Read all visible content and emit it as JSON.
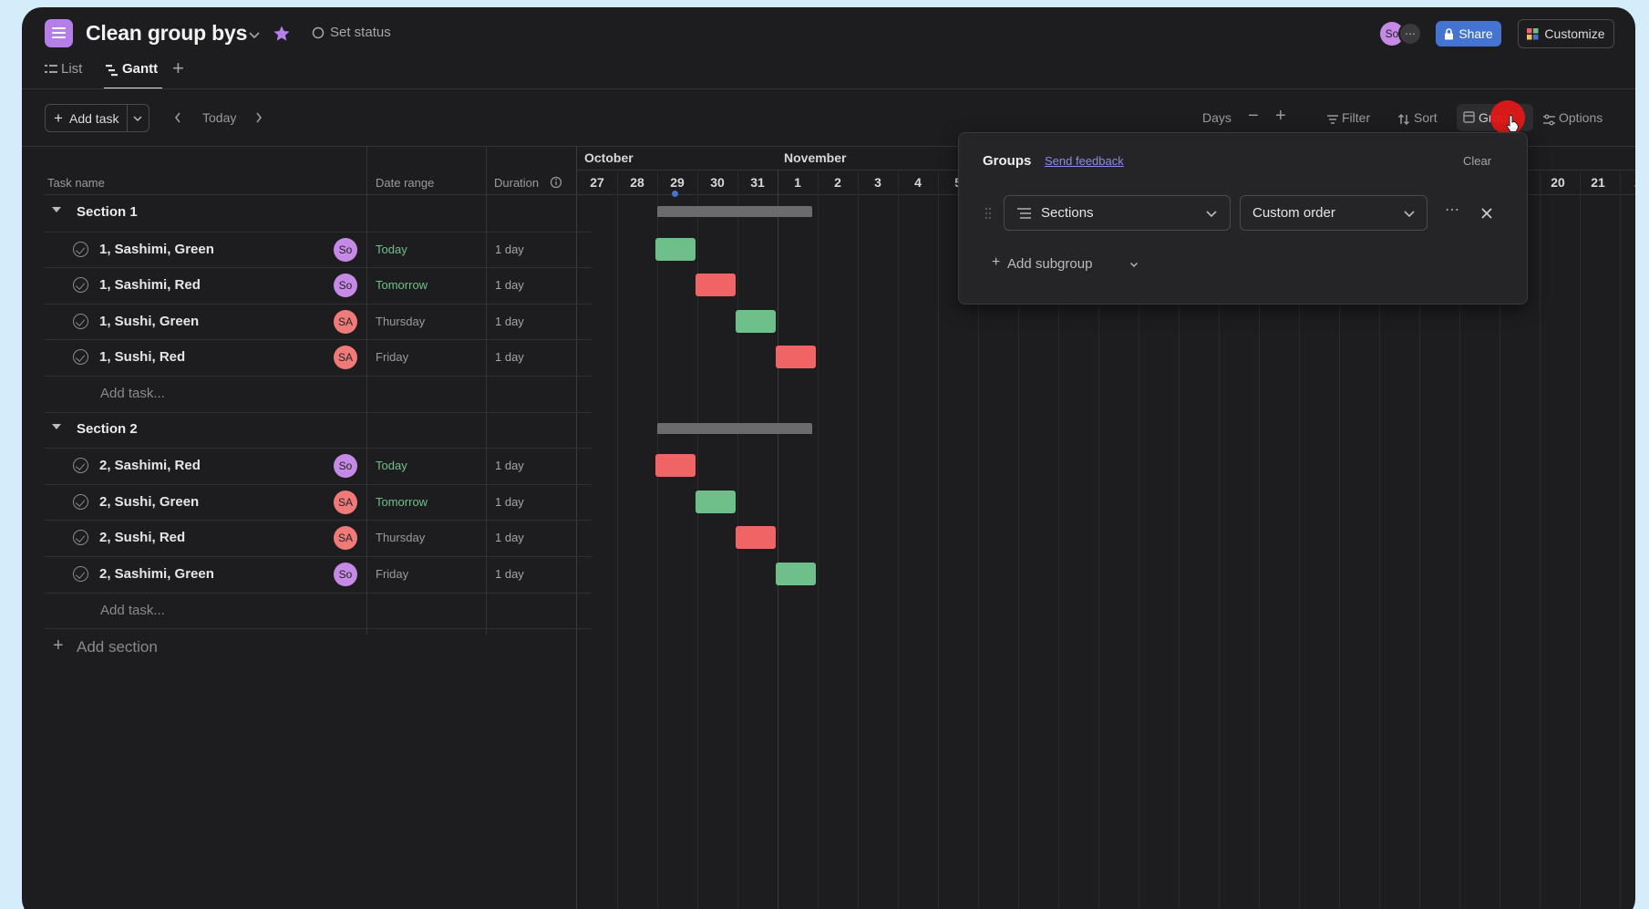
{
  "header": {
    "title": "Clean group bys",
    "set_status": "Set status",
    "share": "Share",
    "customize": "Customize",
    "avatar": "So"
  },
  "tabs": [
    {
      "label": "List"
    },
    {
      "label": "Gantt"
    }
  ],
  "toolbar": {
    "add_task": "Add task",
    "today": "Today",
    "days": "Days",
    "filter": "Filter",
    "sort": "Sort",
    "group": "Group",
    "options": "Options"
  },
  "columns": {
    "task_name": "Task name",
    "date_range": "Date range",
    "duration": "Duration"
  },
  "timeline": {
    "months": [
      "October",
      "November"
    ],
    "days": [
      "27",
      "28",
      "29",
      "30",
      "31",
      "1",
      "2",
      "3",
      "4",
      "5",
      "20",
      "21",
      "2"
    ]
  },
  "sections": [
    {
      "name": "Section 1",
      "add_task": "Add task...",
      "tasks": [
        {
          "name": "1, Sashimi, Green",
          "assignee": "So",
          "date": "Today",
          "duration": "1 day",
          "color": "green"
        },
        {
          "name": "1, Sashimi, Red",
          "assignee": "So",
          "date": "Tomorrow",
          "duration": "1 day",
          "color": "red"
        },
        {
          "name": "1, Sushi, Green",
          "assignee": "SA",
          "date": "Thursday",
          "duration": "1 day",
          "color": "green"
        },
        {
          "name": "1, Sushi, Red",
          "assignee": "SA",
          "date": "Friday",
          "duration": "1 day",
          "color": "red"
        }
      ]
    },
    {
      "name": "Section 2",
      "add_task": "Add task...",
      "tasks": [
        {
          "name": "2, Sashimi, Red",
          "assignee": "So",
          "date": "Today",
          "duration": "1 day",
          "color": "red"
        },
        {
          "name": "2, Sushi, Green",
          "assignee": "SA",
          "date": "Tomorrow",
          "duration": "1 day",
          "color": "green"
        },
        {
          "name": "2, Sushi, Red",
          "assignee": "SA",
          "date": "Thursday",
          "duration": "1 day",
          "color": "red"
        },
        {
          "name": "2, Sashimi, Green",
          "assignee": "So",
          "date": "Friday",
          "duration": "1 day",
          "color": "green"
        }
      ]
    }
  ],
  "add_section": "Add section",
  "groups_panel": {
    "title": "Groups",
    "send_feedback": "Send feedback",
    "clear": "Clear",
    "group_by": "Sections",
    "order": "Custom order",
    "add_subgroup": "Add subgroup"
  },
  "colors": {
    "green_bar": "#6fbf8a",
    "red_bar": "#f06465",
    "share_blue": "#4573d2",
    "project_icon": "#b57ee8",
    "avatar_so": "#c58ae6",
    "avatar_sa": "#f07a7a"
  }
}
